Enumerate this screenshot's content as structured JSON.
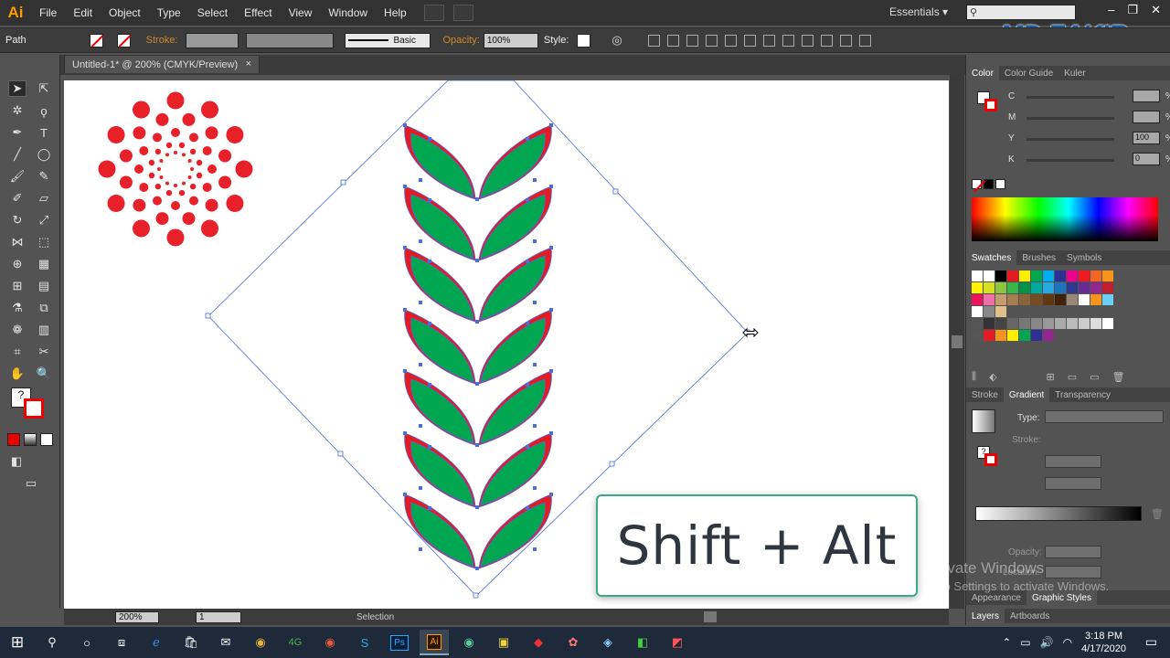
{
  "app": {
    "logo": "Ai",
    "workspace": "Essentials",
    "search_placeholder": ""
  },
  "menu": [
    "File",
    "Edit",
    "Object",
    "Type",
    "Select",
    "Effect",
    "View",
    "Window",
    "Help"
  ],
  "control_bar": {
    "selection_type": "Path",
    "stroke_label": "Stroke:",
    "stroke_style": "Basic",
    "opacity_label": "Opacity:",
    "opacity_value": "100%",
    "style_label": "Style:"
  },
  "document_tab": {
    "title": "Untitled-1* @ 200% (CMYK/Preview)",
    "close": "×"
  },
  "status": {
    "zoom": "200%",
    "artboard": "1",
    "tool": "Selection"
  },
  "color_panel": {
    "tabs": [
      "Color",
      "Color Guide",
      "Kuler"
    ],
    "channels": [
      {
        "label": "C",
        "value": "",
        "pct": "%"
      },
      {
        "label": "M",
        "value": "",
        "pct": "%"
      },
      {
        "label": "Y",
        "value": "100",
        "pct": "%"
      },
      {
        "label": "K",
        "value": "0",
        "pct": "%"
      }
    ]
  },
  "swatches_panel": {
    "tabs": [
      "Swatches",
      "Brushes",
      "Symbols"
    ]
  },
  "gradient_panel": {
    "tabs": [
      "Stroke",
      "Gradient",
      "Transparency"
    ],
    "type_label": "Type:",
    "stroke_label": "Stroke:",
    "opacity_label": "Opacity:",
    "location_label": "Location:"
  },
  "bottom_tabs": {
    "row1": [
      "Appearance",
      "Graphic Styles"
    ],
    "row2": [
      "Layers",
      "Artboards"
    ]
  },
  "overlay_text": "Shift + Alt",
  "watermark": "MD ZAKIR",
  "activate_windows": {
    "line1": "Activate Windows",
    "line2": "Go to Settings to activate Windows."
  },
  "taskbar": {
    "time": "3:18 PM",
    "date": "4/17/2020"
  },
  "colors": {
    "leaf_green": "#00a650",
    "leaf_red": "#e31b23",
    "dot_red": "#e8202a",
    "selection_blue": "#4a6fd8"
  }
}
